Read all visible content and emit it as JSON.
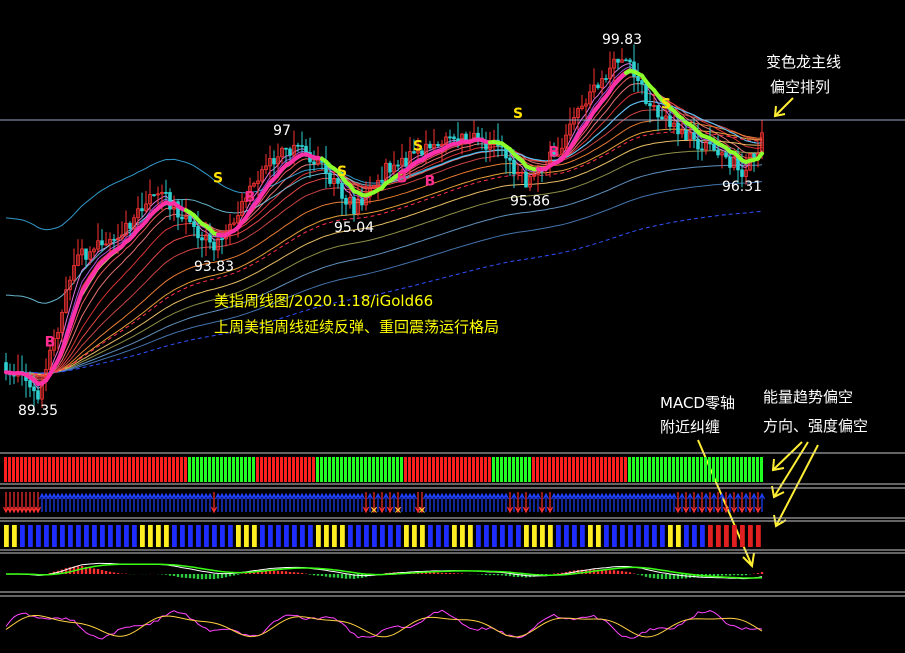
{
  "chart_data": {
    "type": "candlestick",
    "title": "美指周线图/2020.1.18/iGold66",
    "subtitle": "上周美指周线延续反弹、重回震荡运行格局",
    "price_range": [
      88.2,
      101.2
    ],
    "price_labels": [
      {
        "text": "89.35",
        "value": 89.35,
        "bar": 8
      },
      {
        "text": "93.83",
        "value": 93.83,
        "bar": 52
      },
      {
        "text": "97",
        "value": 97.0,
        "bar": 69
      },
      {
        "text": "95.04",
        "value": 95.04,
        "bar": 87
      },
      {
        "text": "95.86",
        "value": 95.86,
        "bar": 131
      },
      {
        "text": "99.83",
        "value": 99.83,
        "bar": 154
      },
      {
        "text": "96.31",
        "value": 96.31,
        "bar": 184
      }
    ],
    "bar_count": 190,
    "current_level": 97.25,
    "anchor_points": [
      [
        0,
        90.2
      ],
      [
        8,
        89.35
      ],
      [
        18,
        93.6
      ],
      [
        28,
        94.3
      ],
      [
        38,
        95.7
      ],
      [
        52,
        93.83
      ],
      [
        60,
        95.4
      ],
      [
        69,
        97.0
      ],
      [
        78,
        96.6
      ],
      [
        87,
        95.04
      ],
      [
        96,
        96.4
      ],
      [
        104,
        96.9
      ],
      [
        112,
        97.4
      ],
      [
        122,
        97.1
      ],
      [
        131,
        95.86
      ],
      [
        140,
        97.3
      ],
      [
        146,
        98.6
      ],
      [
        154,
        99.83
      ],
      [
        162,
        98.1
      ],
      [
        170,
        97.4
      ],
      [
        178,
        96.8
      ],
      [
        184,
        96.31
      ],
      [
        189,
        97.2
      ]
    ],
    "signals": [
      {
        "text": "B",
        "bar": 11,
        "value": 90.8,
        "color": "#ff2d8f"
      },
      {
        "text": "S",
        "bar": 53,
        "value": 95.9,
        "color": "#ffe000"
      },
      {
        "text": "B",
        "bar": 61,
        "value": 95.3,
        "color": "#ff2d8f"
      },
      {
        "text": "S",
        "bar": 84,
        "value": 96.1,
        "color": "#ffe000"
      },
      {
        "text": "S",
        "bar": 103,
        "value": 96.9,
        "color": "#ffe000"
      },
      {
        "text": "B",
        "bar": 99,
        "value": 95.9,
        "color": "#ff2d8f"
      },
      {
        "text": "B",
        "bar": 106,
        "value": 95.8,
        "color": "#ff2d8f"
      },
      {
        "text": "S",
        "bar": 128,
        "value": 97.9,
        "color": "#ffe000"
      },
      {
        "text": "B",
        "bar": 137,
        "value": 96.7,
        "color": "#ff2d8f"
      },
      {
        "text": "S",
        "bar": 165,
        "value": 98.2,
        "color": "#ffe000"
      }
    ],
    "annotations": [
      {
        "lines": [
          "变色龙主线",
          "偏空排列"
        ]
      },
      {
        "lines": [
          "MACD零轴",
          "附近纠缠"
        ]
      },
      {
        "lines": [
          "能量趋势偏空",
          "方向、强度偏空"
        ]
      }
    ],
    "indicator_panels": [
      {
        "name": "color-blocks",
        "colors_by_range": [
          [
            0,
            46,
            "#ff1e1e"
          ],
          [
            46,
            63,
            "#22ff22"
          ],
          [
            63,
            78,
            "#ff1e1e"
          ],
          [
            78,
            100,
            "#22ff22"
          ],
          [
            100,
            122,
            "#ff1e1e"
          ],
          [
            122,
            132,
            "#22ff22"
          ],
          [
            132,
            156,
            "#ff1e1e"
          ],
          [
            156,
            190,
            "#22ff22"
          ]
        ]
      },
      {
        "name": "arrow-strip",
        "down_arrow_bars": [
          0,
          1,
          2,
          3,
          4,
          5,
          6,
          7,
          8,
          52,
          90,
          92,
          94,
          96,
          98,
          103,
          104,
          126,
          128,
          130,
          134,
          136,
          168,
          170,
          172,
          174,
          176,
          178,
          180,
          182,
          184,
          186,
          188
        ]
      },
      {
        "name": "yellow-blue-bars",
        "yellow_ranges": [
          [
            0,
            4
          ],
          [
            34,
            42
          ],
          [
            58,
            64
          ],
          [
            78,
            86
          ],
          [
            100,
            106
          ],
          [
            112,
            118
          ],
          [
            130,
            138
          ],
          [
            146,
            150
          ],
          [
            166,
            170
          ]
        ],
        "red_from_bar": 176
      },
      {
        "name": "macd"
      },
      {
        "name": "oscillator"
      }
    ]
  }
}
